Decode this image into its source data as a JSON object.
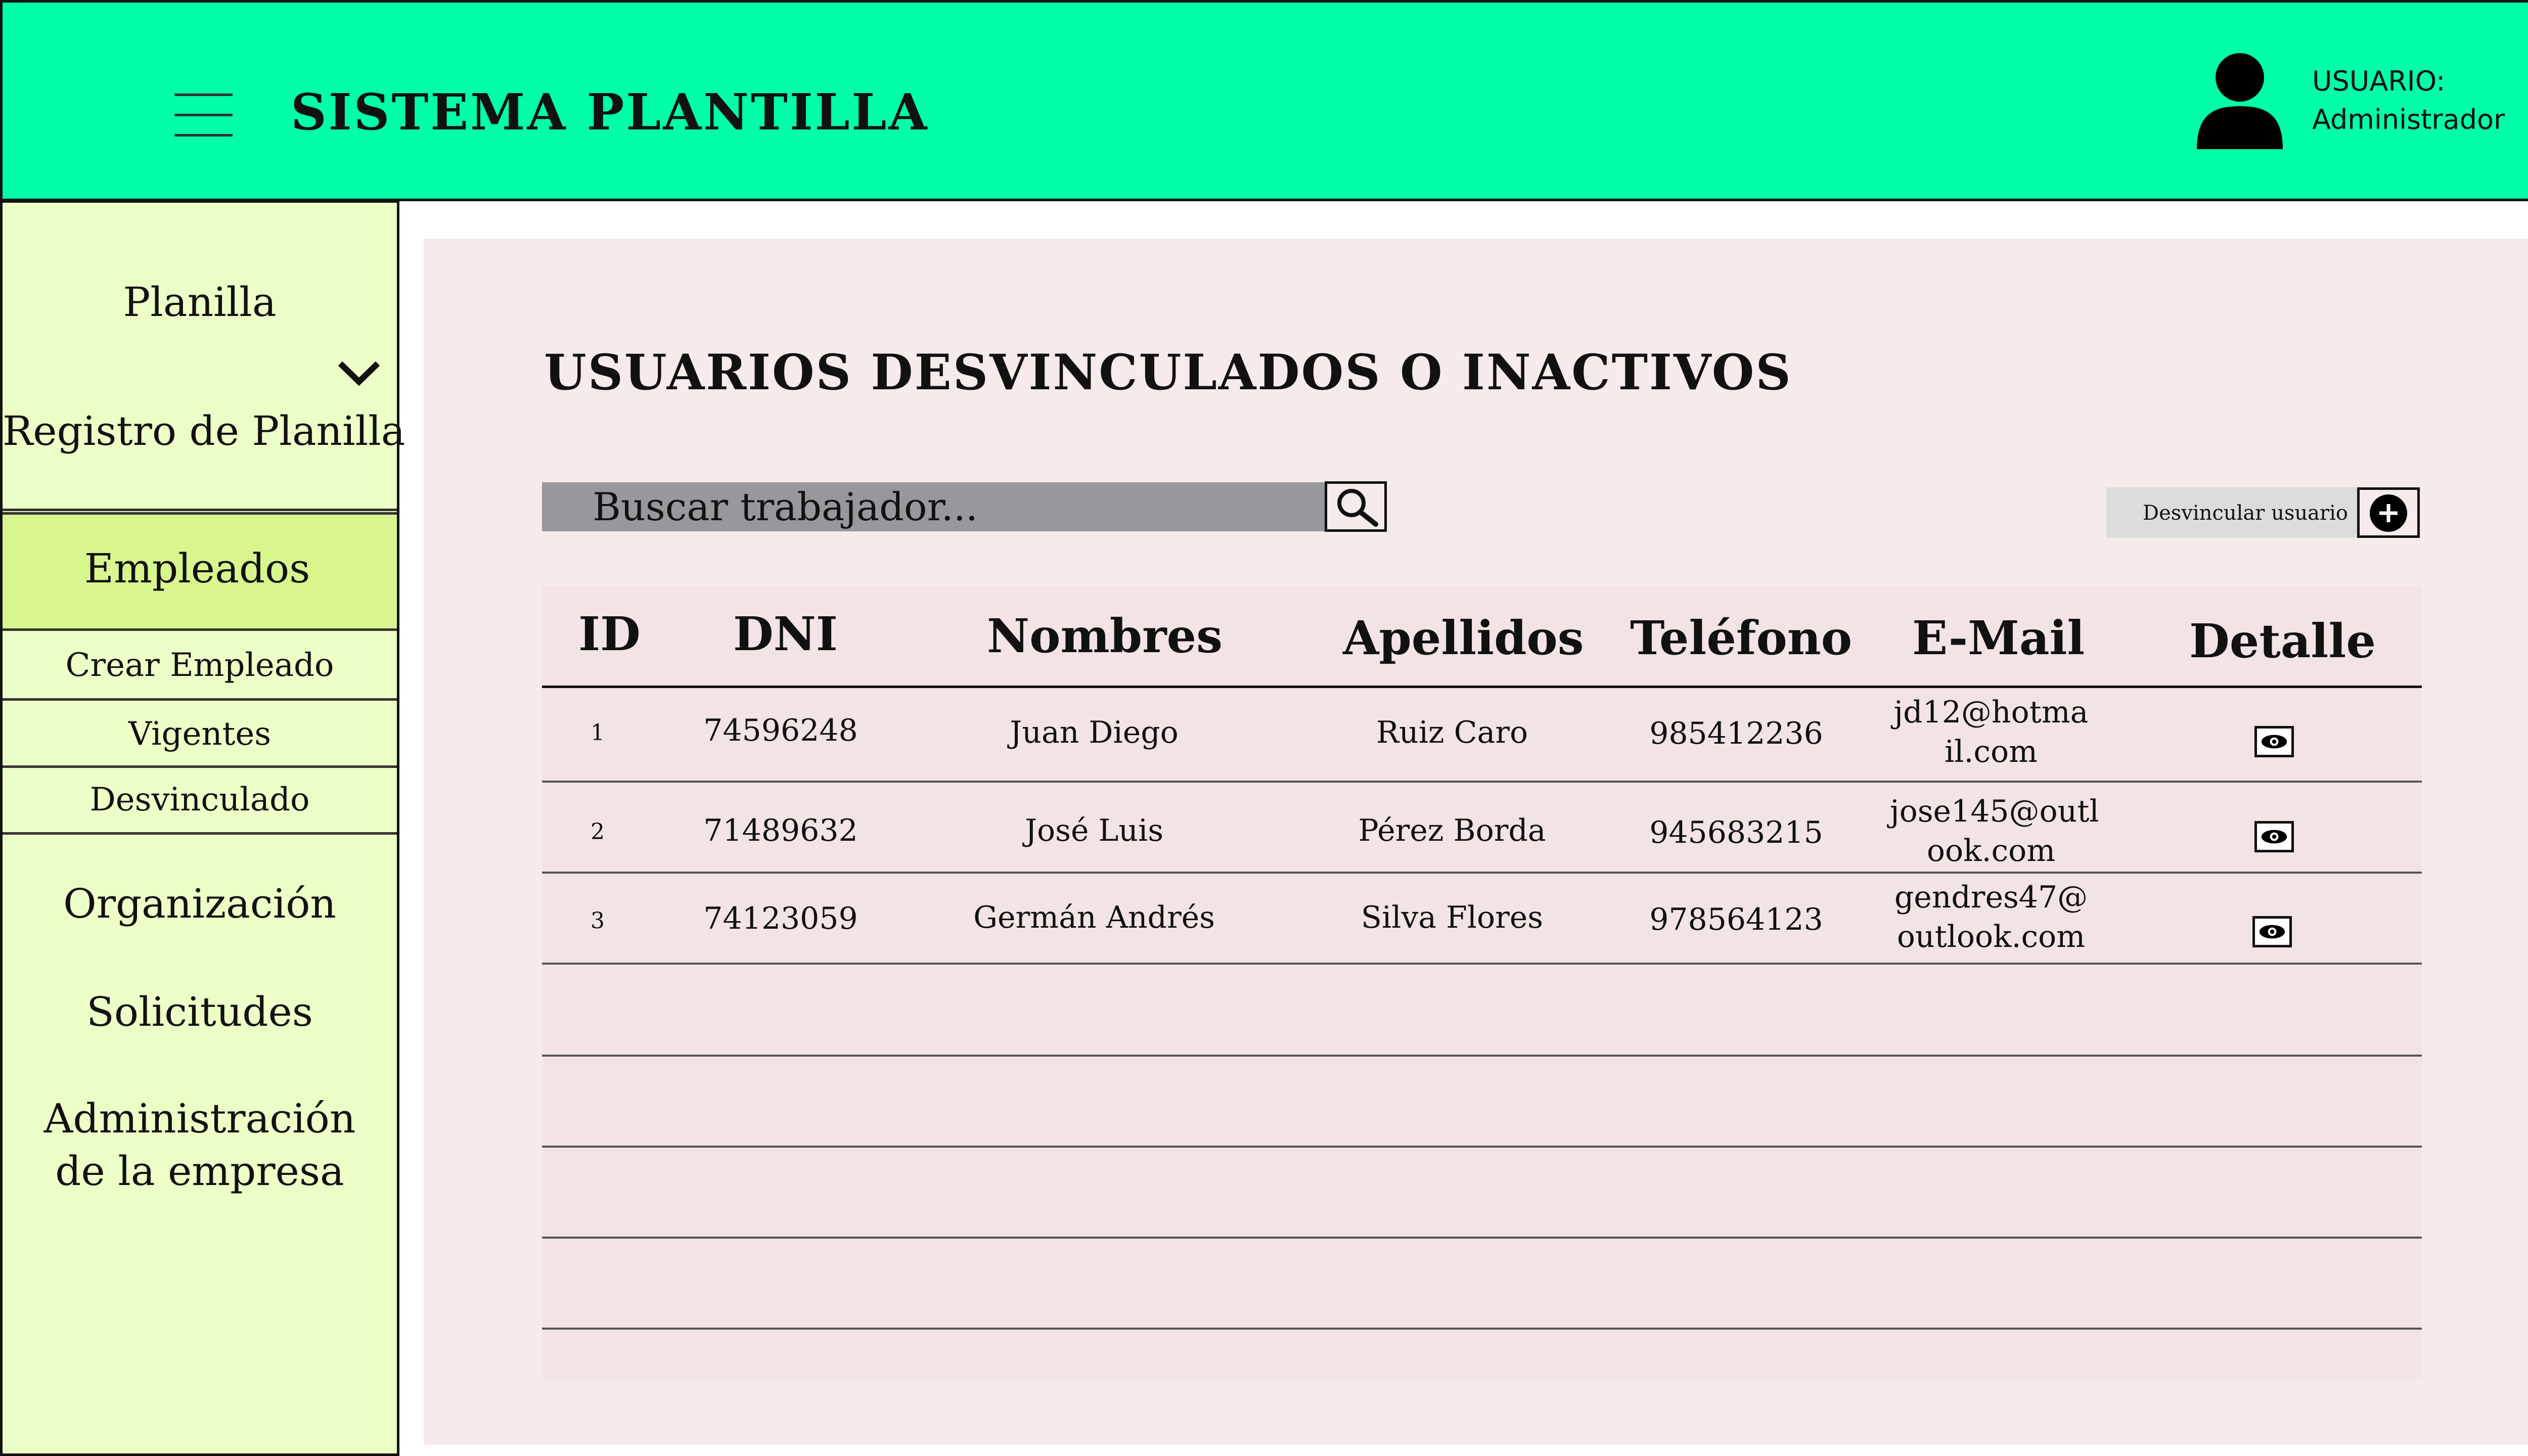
{
  "header": {
    "app_title": "SISTEMA PLANTILLA",
    "user_label": "USUARIO:",
    "user_name": "Administrador",
    "icons": {
      "menu": "hamburger-icon",
      "user": "user-avatar-icon"
    }
  },
  "sidebar": {
    "items": [
      {
        "label": "Planilla"
      },
      {
        "label": "Registro de Planilla"
      },
      {
        "label": "Empleados",
        "expanded": true
      },
      {
        "label": "Organización"
      },
      {
        "label": "Solicitudes"
      },
      {
        "label": "Administración de la empresa"
      }
    ],
    "subitems": [
      {
        "label": "Crear Empleado"
      },
      {
        "label": "Vigentes"
      },
      {
        "label": "Desvinculado"
      }
    ],
    "admin_line1": "Administración",
    "admin_line2": "de la empresa"
  },
  "main": {
    "title": "USUARIOS DESVINCULADOS O INACTIVOS",
    "search": {
      "placeholder": "Buscar trabajador...",
      "icon": "search-icon"
    },
    "unlink_button": {
      "label": "Desvincular usuario",
      "icon": "plus-circle-icon"
    },
    "table": {
      "columns": [
        "ID",
        "DNI",
        "Nombres",
        "Apellidos",
        "Teléfono",
        "E-Mail",
        "Detalle"
      ],
      "rows": [
        {
          "id": "1",
          "dni": "74596248",
          "nombres": "Juan Diego",
          "apellidos": "Ruiz Caro",
          "telefono": "985412236",
          "email_1": "jd12@hotma",
          "email_2": "il.com"
        },
        {
          "id": "2",
          "dni": "71489632",
          "nombres": "José Luis",
          "apellidos": "Pérez Borda",
          "telefono": "945683215",
          "email_1": "jose145@outl",
          "email_2": "ook.com"
        },
        {
          "id": "3",
          "dni": "74123059",
          "nombres": "Germán Andrés",
          "apellidos": "Silva Flores",
          "telefono": "978564123",
          "email_1": "gendres47@",
          "email_2": "outlook.com"
        }
      ],
      "detail_icon": "eye-icon"
    }
  },
  "colors": {
    "header_bg": "#00ffa6",
    "sidebar_bg": "#ecffc6",
    "sidebar_active_bg": "#d8f58e",
    "panel_bg": "#f5ebeb",
    "search_bg": "#97979c",
    "button_bg": "#dcdcdc"
  }
}
